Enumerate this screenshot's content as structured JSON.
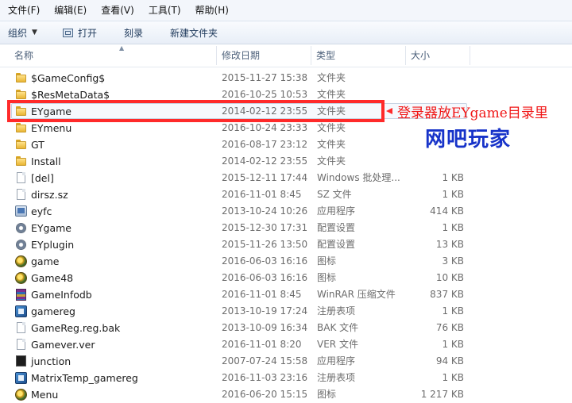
{
  "menu": [
    "文件(F)",
    "编辑(E)",
    "查看(V)",
    "工具(T)",
    "帮助(H)"
  ],
  "toolbar": {
    "organize": "组织",
    "open": "打开",
    "burn": "刻录",
    "new_folder": "新建文件夹"
  },
  "columns": {
    "name": "名称",
    "date": "修改日期",
    "type": "类型",
    "size": "大小"
  },
  "files": [
    {
      "name": "$GameConfig$",
      "date": "2015-11-27 15:38",
      "type": "文件夹",
      "size": "",
      "icon": "folder-icon"
    },
    {
      "name": "$ResMetaData$",
      "date": "2016-10-25 10:53",
      "type": "文件夹",
      "size": "",
      "icon": "folder-icon"
    },
    {
      "name": "EYgame",
      "date": "2014-02-12 23:55",
      "type": "文件夹",
      "size": "",
      "icon": "folder-icon",
      "selected": true
    },
    {
      "name": "EYmenu",
      "date": "2016-10-24 23:33",
      "type": "文件夹",
      "size": "",
      "icon": "folder-icon"
    },
    {
      "name": "GT",
      "date": "2016-08-17 23:12",
      "type": "文件夹",
      "size": "",
      "icon": "folder-icon"
    },
    {
      "name": "Install",
      "date": "2014-02-12 23:55",
      "type": "文件夹",
      "size": "",
      "icon": "folder-icon"
    },
    {
      "name": "[del]",
      "date": "2015-12-11 17:44",
      "type": "Windows 批处理...",
      "size": "1 KB",
      "icon": "batch-file-icon"
    },
    {
      "name": "dirsz.sz",
      "date": "2016-11-01 8:45",
      "type": "SZ 文件",
      "size": "1 KB",
      "icon": "document-icon"
    },
    {
      "name": "eyfc",
      "date": "2013-10-24 10:26",
      "type": "应用程序",
      "size": "414 KB",
      "icon": "application-icon"
    },
    {
      "name": "EYgame",
      "date": "2015-12-30 17:31",
      "type": "配置设置",
      "size": "1 KB",
      "icon": "config-gear-icon"
    },
    {
      "name": "EYplugin",
      "date": "2015-11-26 13:50",
      "type": "配置设置",
      "size": "13 KB",
      "icon": "config-gear-icon"
    },
    {
      "name": "game",
      "date": "2016-06-03 16:16",
      "type": "图标",
      "size": "3 KB",
      "icon": "game-icon"
    },
    {
      "name": "Game48",
      "date": "2016-06-03 16:16",
      "type": "图标",
      "size": "10 KB",
      "icon": "game-icon"
    },
    {
      "name": "GameInfodb",
      "date": "2016-11-01 8:45",
      "type": "WinRAR 压缩文件",
      "size": "837 KB",
      "icon": "winrar-archive-icon"
    },
    {
      "name": "gamereg",
      "date": "2013-10-19 17:24",
      "type": "注册表项",
      "size": "1 KB",
      "icon": "registry-icon"
    },
    {
      "name": "GameReg.reg.bak",
      "date": "2013-10-09 16:34",
      "type": "BAK 文件",
      "size": "76 KB",
      "icon": "document-icon"
    },
    {
      "name": "Gamever.ver",
      "date": "2016-11-01 8:20",
      "type": "VER 文件",
      "size": "1 KB",
      "icon": "document-icon"
    },
    {
      "name": "junction",
      "date": "2007-07-24 15:58",
      "type": "应用程序",
      "size": "94 KB",
      "icon": "junction-app-icon"
    },
    {
      "name": "MatrixTemp_gamereg",
      "date": "2016-11-03 23:16",
      "type": "注册表项",
      "size": "1 KB",
      "icon": "registry-icon"
    },
    {
      "name": "Menu",
      "date": "2016-06-20 15:15",
      "type": "图标",
      "size": "1 217 KB",
      "icon": "game-icon"
    }
  ],
  "annotations": {
    "line1": "登录器放EYgame目录里",
    "line2": "网吧玩家",
    "highlight_color": "#ff2a2a",
    "line2_color": "#1733c9"
  }
}
